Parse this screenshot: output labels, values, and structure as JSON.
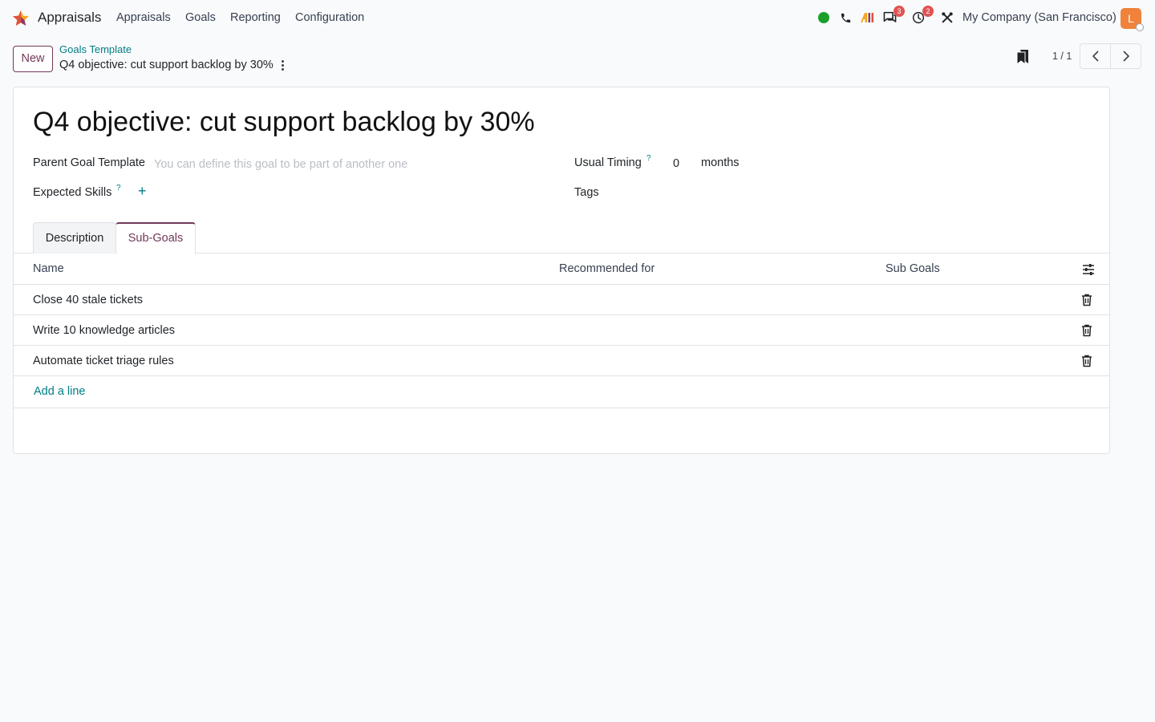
{
  "navbar": {
    "app_name": "Appraisals",
    "menu": [
      "Appraisals",
      "Goals",
      "Reporting",
      "Configuration"
    ],
    "messages_badge": "3",
    "activities_badge": "2",
    "company": "My Company (San Francisco)",
    "avatar_initial": "L",
    "status_color": "#1a9f29",
    "accent_color": "#71385a",
    "link_color": "#017e84"
  },
  "control_panel": {
    "new_label": "New",
    "breadcrumb_parent": "Goals Template",
    "breadcrumb_current": "Q4 objective: cut support backlog by 30%",
    "pager_value": "1 / 1"
  },
  "form": {
    "title": "Q4 objective: cut support backlog by 30%",
    "parent_goal_label": "Parent Goal Template",
    "parent_goal_placeholder": "You can define this goal to be part of another one",
    "usual_timing_label": "Usual Timing",
    "usual_timing_value": "0",
    "usual_timing_unit": "months",
    "expected_skills_label": "Expected Skills",
    "tags_label": "Tags",
    "help_mark": "?",
    "add_symbol": "+"
  },
  "tabs": [
    {
      "label": "Description",
      "active": false
    },
    {
      "label": "Sub-Goals",
      "active": true
    }
  ],
  "subgoals": {
    "columns": [
      "Name",
      "Recommended for",
      "Sub Goals"
    ],
    "rows": [
      {
        "name": "Close 40 stale tickets",
        "recommended_for": "",
        "sub_goals": ""
      },
      {
        "name": "Write 10 knowledge articles",
        "recommended_for": "",
        "sub_goals": ""
      },
      {
        "name": "Automate ticket triage rules",
        "recommended_for": "",
        "sub_goals": ""
      }
    ],
    "add_line_label": "Add a line"
  }
}
